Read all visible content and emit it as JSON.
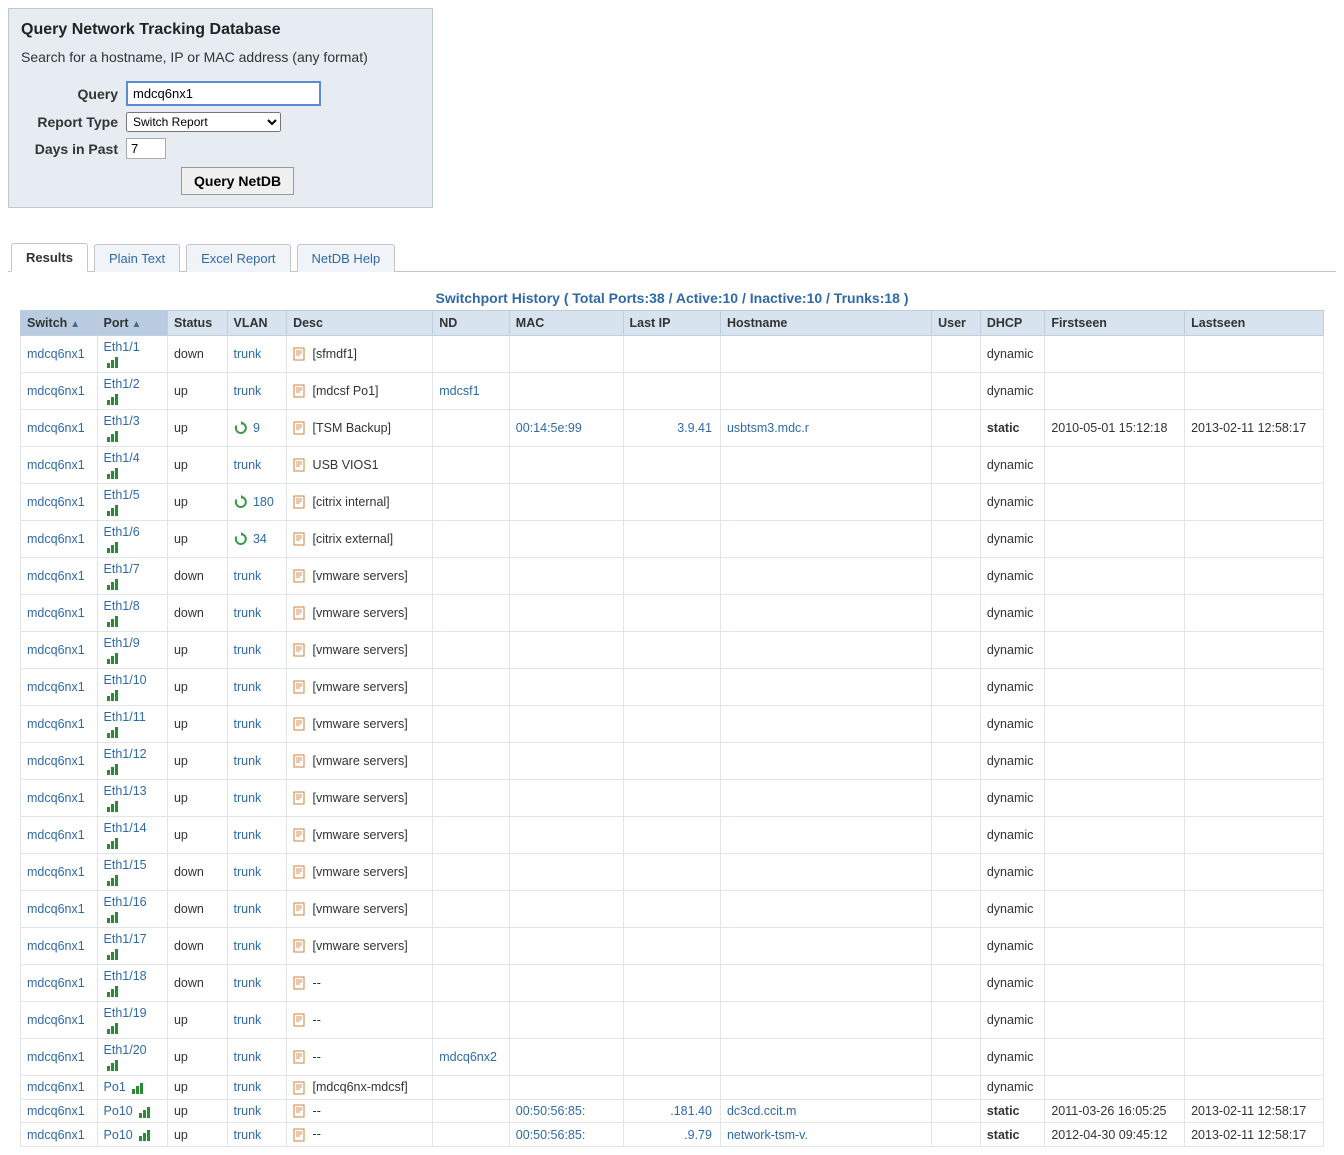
{
  "panel": {
    "title": "Query Network Tracking Database",
    "subtitle": "Search for a hostname, IP or MAC address (any format)",
    "labels": {
      "query": "Query",
      "report_type": "Report Type",
      "days": "Days in Past"
    },
    "values": {
      "query": "mdcq6nx1",
      "report_type": "Switch Report",
      "days": "7"
    },
    "submit": "Query NetDB"
  },
  "tabs": [
    "Results",
    "Plain Text",
    "Excel Report",
    "NetDB Help"
  ],
  "active_tab": 0,
  "summary": "Switchport History ( Total Ports:38 / Active:10 / Inactive:10 / Trunks:18 )",
  "columns": [
    "Switch",
    "Port",
    "Status",
    "VLAN",
    "Desc",
    "ND",
    "MAC",
    "Last IP",
    "Hostname",
    "User",
    "DHCP",
    "Firstseen",
    "Lastseen"
  ],
  "rows": [
    {
      "switch": "mdcq6nx1",
      "port": "Eth1/1",
      "status": "down",
      "vlan": "trunk",
      "vlan_icon": false,
      "desc": "[sfmdf1]",
      "nd": "",
      "mac": "",
      "lastip": "",
      "hostname": "",
      "user": "",
      "dhcp": "dynamic",
      "firstseen": "",
      "lastseen": ""
    },
    {
      "switch": "mdcq6nx1",
      "port": "Eth1/2",
      "status": "up",
      "vlan": "trunk",
      "vlan_icon": false,
      "desc": "[mdcsf Po1]",
      "nd": "mdcsf1",
      "mac": "",
      "lastip": "",
      "hostname": "",
      "user": "",
      "dhcp": "dynamic",
      "firstseen": "",
      "lastseen": ""
    },
    {
      "switch": "mdcq6nx1",
      "port": "Eth1/3",
      "status": "up",
      "vlan": "9",
      "vlan_icon": true,
      "desc": "[TSM Backup]",
      "nd": "",
      "mac": "00:14:5e:99",
      "lastip": "3.9.41",
      "hostname": "usbtsm3.mdc.r",
      "user": "",
      "dhcp": "static",
      "firstseen": "2010-05-01 15:12:18",
      "lastseen": "2013-02-11 12:58:17"
    },
    {
      "switch": "mdcq6nx1",
      "port": "Eth1/4",
      "status": "up",
      "vlan": "trunk",
      "vlan_icon": false,
      "desc": "USB VIOS1",
      "nd": "",
      "mac": "",
      "lastip": "",
      "hostname": "",
      "user": "",
      "dhcp": "dynamic",
      "firstseen": "",
      "lastseen": ""
    },
    {
      "switch": "mdcq6nx1",
      "port": "Eth1/5",
      "status": "up",
      "vlan": "180",
      "vlan_icon": true,
      "desc": "[citrix internal]",
      "nd": "",
      "mac": "",
      "lastip": "",
      "hostname": "",
      "user": "",
      "dhcp": "dynamic",
      "firstseen": "",
      "lastseen": ""
    },
    {
      "switch": "mdcq6nx1",
      "port": "Eth1/6",
      "status": "up",
      "vlan": "34",
      "vlan_icon": true,
      "desc": "[citrix external]",
      "nd": "",
      "mac": "",
      "lastip": "",
      "hostname": "",
      "user": "",
      "dhcp": "dynamic",
      "firstseen": "",
      "lastseen": ""
    },
    {
      "switch": "mdcq6nx1",
      "port": "Eth1/7",
      "status": "down",
      "vlan": "trunk",
      "vlan_icon": false,
      "desc": "[vmware servers]",
      "nd": "",
      "mac": "",
      "lastip": "",
      "hostname": "",
      "user": "",
      "dhcp": "dynamic",
      "firstseen": "",
      "lastseen": ""
    },
    {
      "switch": "mdcq6nx1",
      "port": "Eth1/8",
      "status": "down",
      "vlan": "trunk",
      "vlan_icon": false,
      "desc": "[vmware servers]",
      "nd": "",
      "mac": "",
      "lastip": "",
      "hostname": "",
      "user": "",
      "dhcp": "dynamic",
      "firstseen": "",
      "lastseen": ""
    },
    {
      "switch": "mdcq6nx1",
      "port": "Eth1/9",
      "status": "up",
      "vlan": "trunk",
      "vlan_icon": false,
      "desc": "[vmware servers]",
      "nd": "",
      "mac": "",
      "lastip": "",
      "hostname": "",
      "user": "",
      "dhcp": "dynamic",
      "firstseen": "",
      "lastseen": ""
    },
    {
      "switch": "mdcq6nx1",
      "port": "Eth1/10",
      "status": "up",
      "vlan": "trunk",
      "vlan_icon": false,
      "desc": "[vmware servers]",
      "nd": "",
      "mac": "",
      "lastip": "",
      "hostname": "",
      "user": "",
      "dhcp": "dynamic",
      "firstseen": "",
      "lastseen": ""
    },
    {
      "switch": "mdcq6nx1",
      "port": "Eth1/11",
      "status": "up",
      "vlan": "trunk",
      "vlan_icon": false,
      "desc": "[vmware servers]",
      "nd": "",
      "mac": "",
      "lastip": "",
      "hostname": "",
      "user": "",
      "dhcp": "dynamic",
      "firstseen": "",
      "lastseen": ""
    },
    {
      "switch": "mdcq6nx1",
      "port": "Eth1/12",
      "status": "up",
      "vlan": "trunk",
      "vlan_icon": false,
      "desc": "[vmware servers]",
      "nd": "",
      "mac": "",
      "lastip": "",
      "hostname": "",
      "user": "",
      "dhcp": "dynamic",
      "firstseen": "",
      "lastseen": ""
    },
    {
      "switch": "mdcq6nx1",
      "port": "Eth1/13",
      "status": "up",
      "vlan": "trunk",
      "vlan_icon": false,
      "desc": "[vmware servers]",
      "nd": "",
      "mac": "",
      "lastip": "",
      "hostname": "",
      "user": "",
      "dhcp": "dynamic",
      "firstseen": "",
      "lastseen": ""
    },
    {
      "switch": "mdcq6nx1",
      "port": "Eth1/14",
      "status": "up",
      "vlan": "trunk",
      "vlan_icon": false,
      "desc": "[vmware servers]",
      "nd": "",
      "mac": "",
      "lastip": "",
      "hostname": "",
      "user": "",
      "dhcp": "dynamic",
      "firstseen": "",
      "lastseen": ""
    },
    {
      "switch": "mdcq6nx1",
      "port": "Eth1/15",
      "status": "down",
      "vlan": "trunk",
      "vlan_icon": false,
      "desc": "[vmware servers]",
      "nd": "",
      "mac": "",
      "lastip": "",
      "hostname": "",
      "user": "",
      "dhcp": "dynamic",
      "firstseen": "",
      "lastseen": ""
    },
    {
      "switch": "mdcq6nx1",
      "port": "Eth1/16",
      "status": "down",
      "vlan": "trunk",
      "vlan_icon": false,
      "desc": "[vmware servers]",
      "nd": "",
      "mac": "",
      "lastip": "",
      "hostname": "",
      "user": "",
      "dhcp": "dynamic",
      "firstseen": "",
      "lastseen": ""
    },
    {
      "switch": "mdcq6nx1",
      "port": "Eth1/17",
      "status": "down",
      "vlan": "trunk",
      "vlan_icon": false,
      "desc": "[vmware servers]",
      "nd": "",
      "mac": "",
      "lastip": "",
      "hostname": "",
      "user": "",
      "dhcp": "dynamic",
      "firstseen": "",
      "lastseen": ""
    },
    {
      "switch": "mdcq6nx1",
      "port": "Eth1/18",
      "status": "down",
      "vlan": "trunk",
      "vlan_icon": false,
      "desc": "--",
      "nd": "",
      "mac": "",
      "lastip": "",
      "hostname": "",
      "user": "",
      "dhcp": "dynamic",
      "firstseen": "",
      "lastseen": ""
    },
    {
      "switch": "mdcq6nx1",
      "port": "Eth1/19",
      "status": "up",
      "vlan": "trunk",
      "vlan_icon": false,
      "desc": "--",
      "nd": "",
      "mac": "",
      "lastip": "",
      "hostname": "",
      "user": "",
      "dhcp": "dynamic",
      "firstseen": "",
      "lastseen": ""
    },
    {
      "switch": "mdcq6nx1",
      "port": "Eth1/20",
      "status": "up",
      "vlan": "trunk",
      "vlan_icon": false,
      "desc": "--",
      "nd": "mdcq6nx2",
      "mac": "",
      "lastip": "",
      "hostname": "",
      "user": "",
      "dhcp": "dynamic",
      "firstseen": "",
      "lastseen": ""
    },
    {
      "switch": "mdcq6nx1",
      "port": "Po1",
      "status": "up",
      "vlan": "trunk",
      "vlan_icon": false,
      "desc": "[mdcq6nx-mdcsf]",
      "nd": "",
      "mac": "",
      "lastip": "",
      "hostname": "",
      "user": "",
      "dhcp": "dynamic",
      "firstseen": "",
      "lastseen": ""
    },
    {
      "switch": "mdcq6nx1",
      "port": "Po10",
      "status": "up",
      "vlan": "trunk",
      "vlan_icon": false,
      "desc": "--",
      "nd": "",
      "mac": "00:50:56:85:",
      "lastip": ".181.40",
      "hostname": "dc3cd.ccit.m",
      "user": "",
      "dhcp": "static",
      "firstseen": "2011-03-26 16:05:25",
      "lastseen": "2013-02-11 12:58:17"
    },
    {
      "switch": "mdcq6nx1",
      "port": "Po10",
      "status": "up",
      "vlan": "trunk",
      "vlan_icon": false,
      "desc": "--",
      "nd": "",
      "mac": "00:50:56:85:",
      "lastip": ".9.79",
      "hostname": "network-tsm-v.",
      "user": "",
      "dhcp": "static",
      "firstseen": "2012-04-30 09:45:12",
      "lastseen": "2013-02-11 12:58:17"
    }
  ],
  "col_widths": [
    "65px",
    "65px",
    "55px",
    "55px",
    "135px",
    "60px",
    "105px",
    "90px",
    "195px",
    "45px",
    "55px",
    "120px",
    "120px"
  ]
}
